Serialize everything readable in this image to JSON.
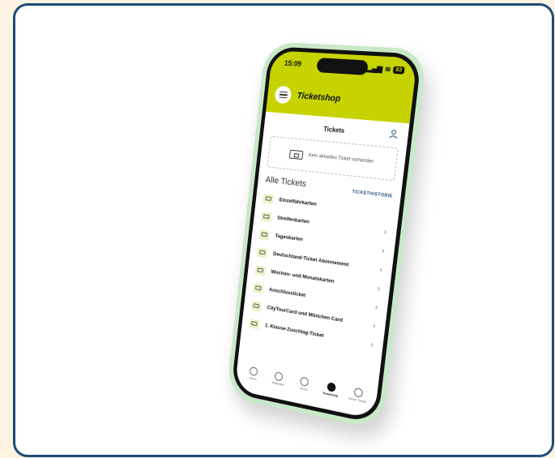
{
  "colors": {
    "accent": "#c6d300",
    "frame": "#1f4a78",
    "phone_case": "#c9e8c8"
  },
  "status": {
    "time": "15:09",
    "battery": "83"
  },
  "header": {
    "title": "Ticketshop"
  },
  "tickets": {
    "title": "Tickets",
    "empty_text": "Kein aktuelles Ticket vorhanden"
  },
  "section": {
    "title": "Alle Tickets",
    "history_link": "TICKETHISTORIE"
  },
  "items": [
    {
      "label": "Einzelfahrkarten"
    },
    {
      "label": "Streifenkarten"
    },
    {
      "label": "Tageskarten"
    },
    {
      "label": "Deutschland-Ticket Abonnement"
    },
    {
      "label": "Wochen- und Monatskarten"
    },
    {
      "label": "Anschlussticket"
    },
    {
      "label": "CityTourCard und München Card"
    },
    {
      "label": "1. Klasse-Zuschlag-Ticket"
    }
  ],
  "tabs": [
    {
      "label": "Suche",
      "icon": "search-icon"
    },
    {
      "label": "Abfahrten",
      "icon": "clock-icon"
    },
    {
      "label": "MVGo",
      "icon": "compass-icon"
    },
    {
      "label": "Ticketshop",
      "icon": "ticketshop-icon"
    },
    {
      "label": "Meine Tickets",
      "icon": "wallet-icon"
    }
  ]
}
